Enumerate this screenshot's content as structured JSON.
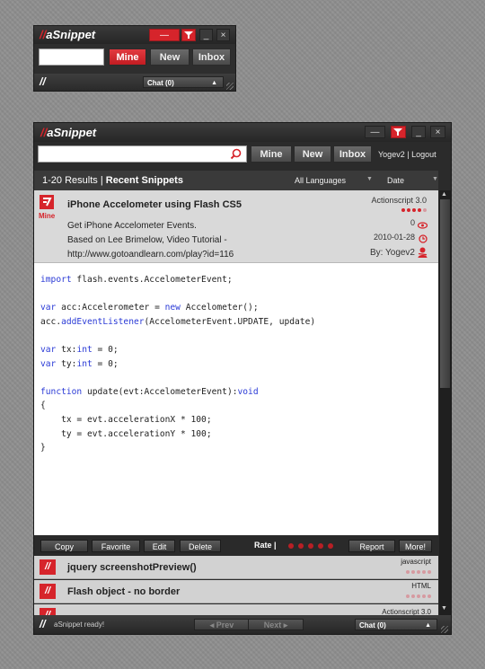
{
  "app": {
    "name": "aSnippet",
    "logo_slash": "//"
  },
  "tabs": {
    "mine": "Mine",
    "new": "New",
    "inbox": "Inbox"
  },
  "window_controls": {
    "minimize": "—",
    "filter": "filter",
    "collapse": "_",
    "close": "×"
  },
  "user": {
    "name": "Yogev2",
    "separator": "|",
    "logout": "Logout"
  },
  "mini": {
    "status_slashes": "//",
    "chat": "Chat (0)"
  },
  "list_header": {
    "range": "1-20 Results",
    "separator": "|",
    "label": "Recent Snippets",
    "language": "All Languages",
    "sort": "Date"
  },
  "selected_snippet": {
    "badge": "Mine",
    "title": "iPhone Accelometer using Flash CS5",
    "description": [
      "Get iPhone Accelometer  Events.",
      "Based on Lee Brimelow, Video Tutorial -",
      "http://www.gotoandlearn.com/play?id=116"
    ],
    "language": "Actionscript 3.0",
    "rating": 4,
    "rating_max": 5,
    "views": "0",
    "date": "2010-01-28",
    "author": "By: Yogev2",
    "code_lines": [
      "import flash.events.AccelometerEvent;",
      "",
      "var acc:Accelerometer = new Accelometer();",
      "acc.addEventListener(AccelometerEvent.UPDATE, update)",
      "",
      "var tx:int = 0;",
      "var ty:int = 0;",
      "",
      "function update(evt:AccelometerEvent):void",
      "{",
      "    tx = evt.accelerationX * 100;",
      "    ty = evt.accelerationY * 100;",
      "}"
    ]
  },
  "actions": {
    "copy": "Copy",
    "favorite": "Favorite",
    "edit": "Edit",
    "delete": "Delete",
    "rate_label": "Rate |",
    "report": "Report",
    "more": "More!"
  },
  "snippets": [
    {
      "title": "jquery screenshotPreview()",
      "language": "javascript"
    },
    {
      "title": "Flash object - no border",
      "language": "HTML"
    },
    {
      "title": "",
      "language": "Actionscript 3.0"
    }
  ],
  "status": {
    "slashes": "//",
    "message": "aSnippet ready!",
    "prev": "◂ Prev",
    "next": "Next ▸",
    "chat": "Chat (0)"
  },
  "colors": {
    "accent": "#d6242b",
    "dark": "#2b2b2b"
  }
}
